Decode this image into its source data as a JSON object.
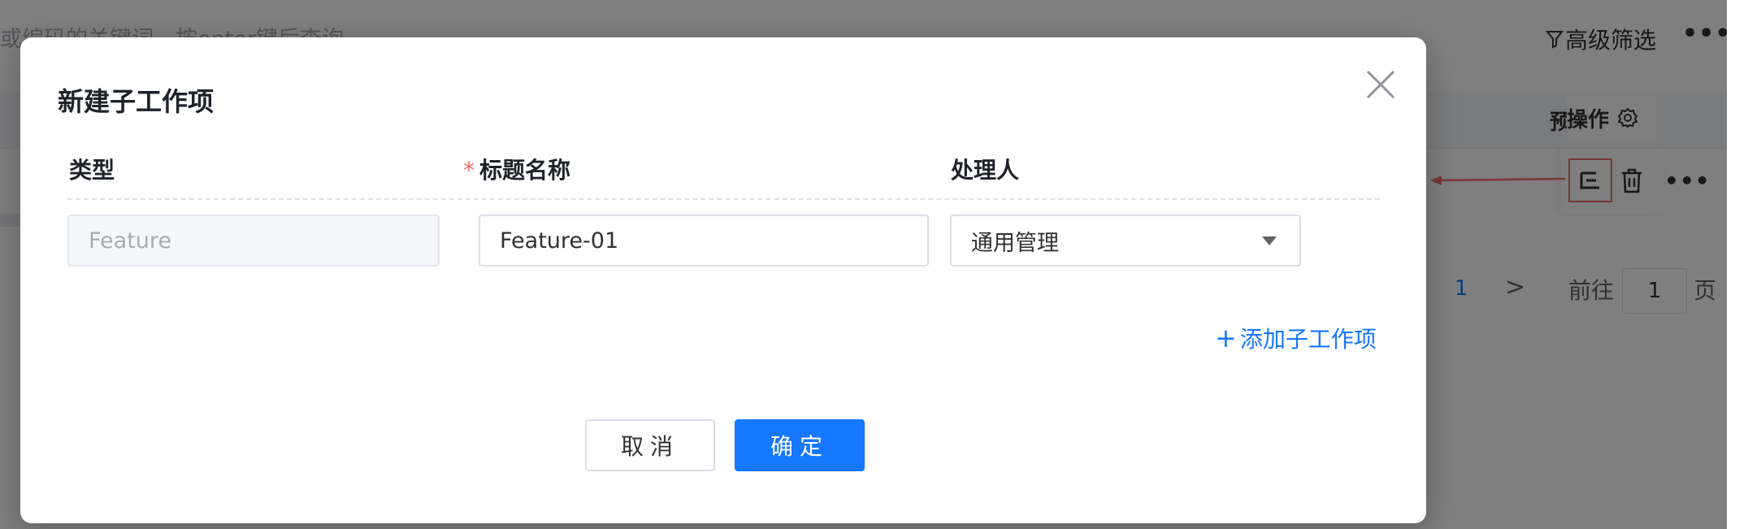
{
  "background": {
    "search_placeholder": "或编码的关键词，按enter键后查询",
    "advanced_filter_label": "高级筛选",
    "more_label": "•••",
    "truncated_column_header": "预",
    "operations_header": "操作",
    "row_more_label": "•••",
    "pagination": {
      "current_page": "1",
      "next_label": ">",
      "goto_label": "前往",
      "goto_value": "1",
      "page_unit": "页"
    }
  },
  "dialog": {
    "title": "新建子工作项",
    "columns": {
      "type": "类型",
      "title_required_mark": "*",
      "title": "标题名称",
      "assignee": "处理人"
    },
    "row": {
      "type_value": "Feature",
      "title_value": "Feature-01",
      "assignee_value": "通用管理"
    },
    "add_sub_item_label": "添加子工作项",
    "add_plus": "+",
    "cancel_label": "取消",
    "confirm_label": "确定"
  },
  "colors": {
    "primary": "#1677ff",
    "danger_highlight": "#f56c6c",
    "overlay": "rgba(0,0,0,0.5)"
  },
  "icons": [
    "filter-icon",
    "gear-icon",
    "sub-item-icon",
    "trash-icon",
    "close-icon",
    "caret-down-icon",
    "plus-icon",
    "more-icon"
  ]
}
